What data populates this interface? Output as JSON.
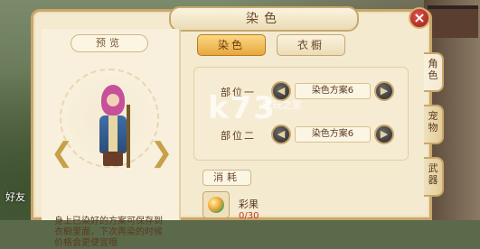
{
  "window": {
    "title": "染色",
    "close_label": "×"
  },
  "preview": {
    "title": "预览",
    "description": "身上已染好的方案可保存到衣橱里面，下次再染的时候价格会更便宜哦"
  },
  "tabs": {
    "active_label": "染色",
    "inactive_label": "衣橱"
  },
  "parts": [
    {
      "label": "部位一",
      "value": "染色方案6"
    },
    {
      "label": "部位二",
      "value": "染色方案6"
    }
  ],
  "consume": {
    "label": "消耗",
    "item_name": "彩果",
    "item_count": "0/30"
  },
  "side_tabs": [
    "角色",
    "宠物",
    "武器"
  ],
  "background": {
    "left_label": "好友"
  },
  "watermark": {
    "main": "k73",
    "sub": "电玩之家"
  },
  "colors": {
    "accent": "#e8a73e",
    "panel": "#f4ead0",
    "border": "#c9a66b",
    "close": "#c0392b"
  }
}
